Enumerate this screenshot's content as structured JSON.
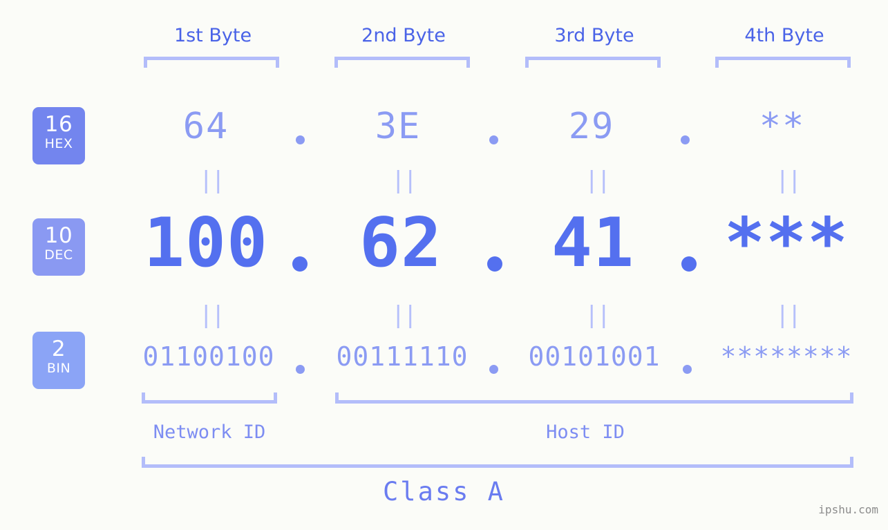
{
  "watermark": "ipshu.com",
  "byte_headers": [
    {
      "label": "1st Byte"
    },
    {
      "label": "2nd Byte"
    },
    {
      "label": "3rd Byte"
    },
    {
      "label": "4th Byte"
    }
  ],
  "bases": [
    {
      "number": "16",
      "abbr": "HEX",
      "color": "#7385ee"
    },
    {
      "number": "10",
      "abbr": "DEC",
      "color": "#8a99f2"
    },
    {
      "number": "2",
      "abbr": "BIN",
      "color": "#8ba4f6"
    }
  ],
  "rows": {
    "hex": {
      "values": [
        "64",
        "3E",
        "29",
        "**"
      ],
      "separator": "."
    },
    "dec": {
      "values": [
        "100",
        "62",
        "41",
        "***"
      ],
      "separator": "."
    },
    "bin": {
      "values": [
        "01100100",
        "00111110",
        "00101001",
        "********"
      ],
      "separator": "."
    }
  },
  "equal_marks": [
    "||",
    "||",
    "||",
    "||",
    "||",
    "||",
    "||",
    "||"
  ],
  "id_spans": [
    {
      "label": "Network ID"
    },
    {
      "label": "Host ID"
    }
  ],
  "class_label": "Class A",
  "colors": {
    "background": "#fbfcf8",
    "header_text": "#4a63e7",
    "bracket": "#b3bdfa",
    "hex_text": "#8b9bf3",
    "dec_text": "#5470ef",
    "bin_text": "#8b9bf3",
    "id_text": "#7d8df2",
    "class_text": "#6a7cf0",
    "watermark_text": "#8c8c8c"
  }
}
